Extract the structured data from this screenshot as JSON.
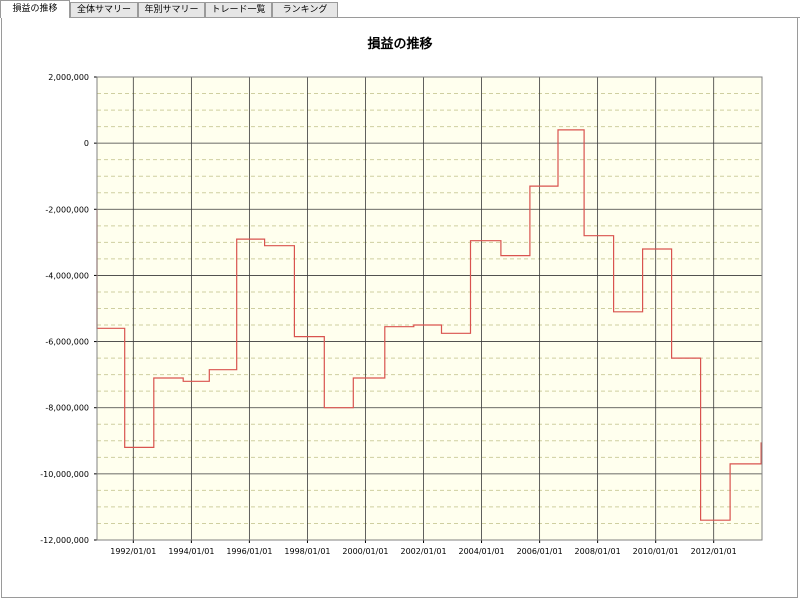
{
  "tabs": [
    {
      "label": "損益の推移",
      "active": true
    },
    {
      "label": "全体サマリー",
      "active": false
    },
    {
      "label": "年別サマリー",
      "active": false
    },
    {
      "label": "トレード一覧",
      "active": false
    },
    {
      "label": "ランキング",
      "active": false
    }
  ],
  "chart_data": {
    "type": "line",
    "title": "損益の推移",
    "xlabel": "",
    "ylabel": "",
    "ylim": [
      -12000000,
      2000000
    ],
    "xlim": [
      "1990-10-01",
      "2013-08-31"
    ],
    "yticks": [
      2000000,
      0,
      -2000000,
      -4000000,
      -6000000,
      -8000000,
      -10000000,
      -12000000
    ],
    "ytick_labels": [
      "2,000,000",
      "0",
      "-2,000,000",
      "-4,000,000",
      "-6,000,000",
      "-8,000,000",
      "-10,000,000",
      "-12,000,000"
    ],
    "xticks": [
      "1992-01-01",
      "1994-01-01",
      "1996-01-01",
      "1998-01-01",
      "2000-01-01",
      "2002-01-01",
      "2004-01-01",
      "2006-01-01",
      "2008-01-01",
      "2010-01-01",
      "2012-01-01"
    ],
    "xtick_labels": [
      "1992/01/01",
      "1994/01/01",
      "1996/01/01",
      "1998/01/01",
      "2000/01/01",
      "2002/01/01",
      "2004/01/01",
      "2006/01/01",
      "2008/01/01",
      "2010/01/01",
      "2012/01/01"
    ],
    "grid": true,
    "colors": {
      "line": "#d9534f",
      "background": "#ffffee",
      "major_grid": "#3a3a3a",
      "minor_grid": "#cfcfa0"
    },
    "series": [
      {
        "step": true,
        "points": [
          [
            "1990-10-01",
            -2000000
          ],
          [
            "1990-10-01",
            -5600000
          ],
          [
            "1991-09-15",
            -5600000
          ],
          [
            "1991-09-15",
            -9200000
          ],
          [
            "1992-09-15",
            -9200000
          ],
          [
            "1992-09-15",
            -7100000
          ],
          [
            "1993-09-20",
            -7100000
          ],
          [
            "1993-09-20",
            -7200000
          ],
          [
            "1994-08-15",
            -7200000
          ],
          [
            "1994-08-15",
            -6850000
          ],
          [
            "1995-07-25",
            -6850000
          ],
          [
            "1995-07-25",
            -2900000
          ],
          [
            "1996-07-10",
            -2900000
          ],
          [
            "1996-07-10",
            -3100000
          ],
          [
            "1997-07-20",
            -3100000
          ],
          [
            "1997-07-20",
            -5850000
          ],
          [
            "1998-08-01",
            -5850000
          ],
          [
            "1998-08-01",
            -8000000
          ],
          [
            "1999-08-01",
            -8000000
          ],
          [
            "1999-08-01",
            -7100000
          ],
          [
            "2000-09-01",
            -7100000
          ],
          [
            "2000-09-01",
            -5550000
          ],
          [
            "2001-09-01",
            -5550000
          ],
          [
            "2001-09-01",
            -5500000
          ],
          [
            "2002-08-15",
            -5500000
          ],
          [
            "2002-08-15",
            -5750000
          ],
          [
            "2003-08-15",
            -5750000
          ],
          [
            "2003-08-15",
            -2950000
          ],
          [
            "2004-09-01",
            -2950000
          ],
          [
            "2004-09-01",
            -3400000
          ],
          [
            "2005-09-01",
            -3400000
          ],
          [
            "2005-09-01",
            -1300000
          ],
          [
            "2006-08-20",
            -1300000
          ],
          [
            "2006-08-20",
            400000
          ],
          [
            "2007-07-15",
            400000
          ],
          [
            "2007-07-15",
            -2800000
          ],
          [
            "2008-07-20",
            -2800000
          ],
          [
            "2008-07-20",
            -5100000
          ],
          [
            "2009-07-20",
            -5100000
          ],
          [
            "2009-07-20",
            -3200000
          ],
          [
            "2010-07-20",
            -3200000
          ],
          [
            "2010-07-20",
            -6500000
          ],
          [
            "2011-07-20",
            -6500000
          ],
          [
            "2011-07-20",
            -11400000
          ],
          [
            "2012-07-25",
            -11400000
          ],
          [
            "2012-07-25",
            -9700000
          ],
          [
            "2013-08-20",
            -9700000
          ],
          [
            "2013-08-20",
            -9050000
          ]
        ]
      }
    ]
  }
}
